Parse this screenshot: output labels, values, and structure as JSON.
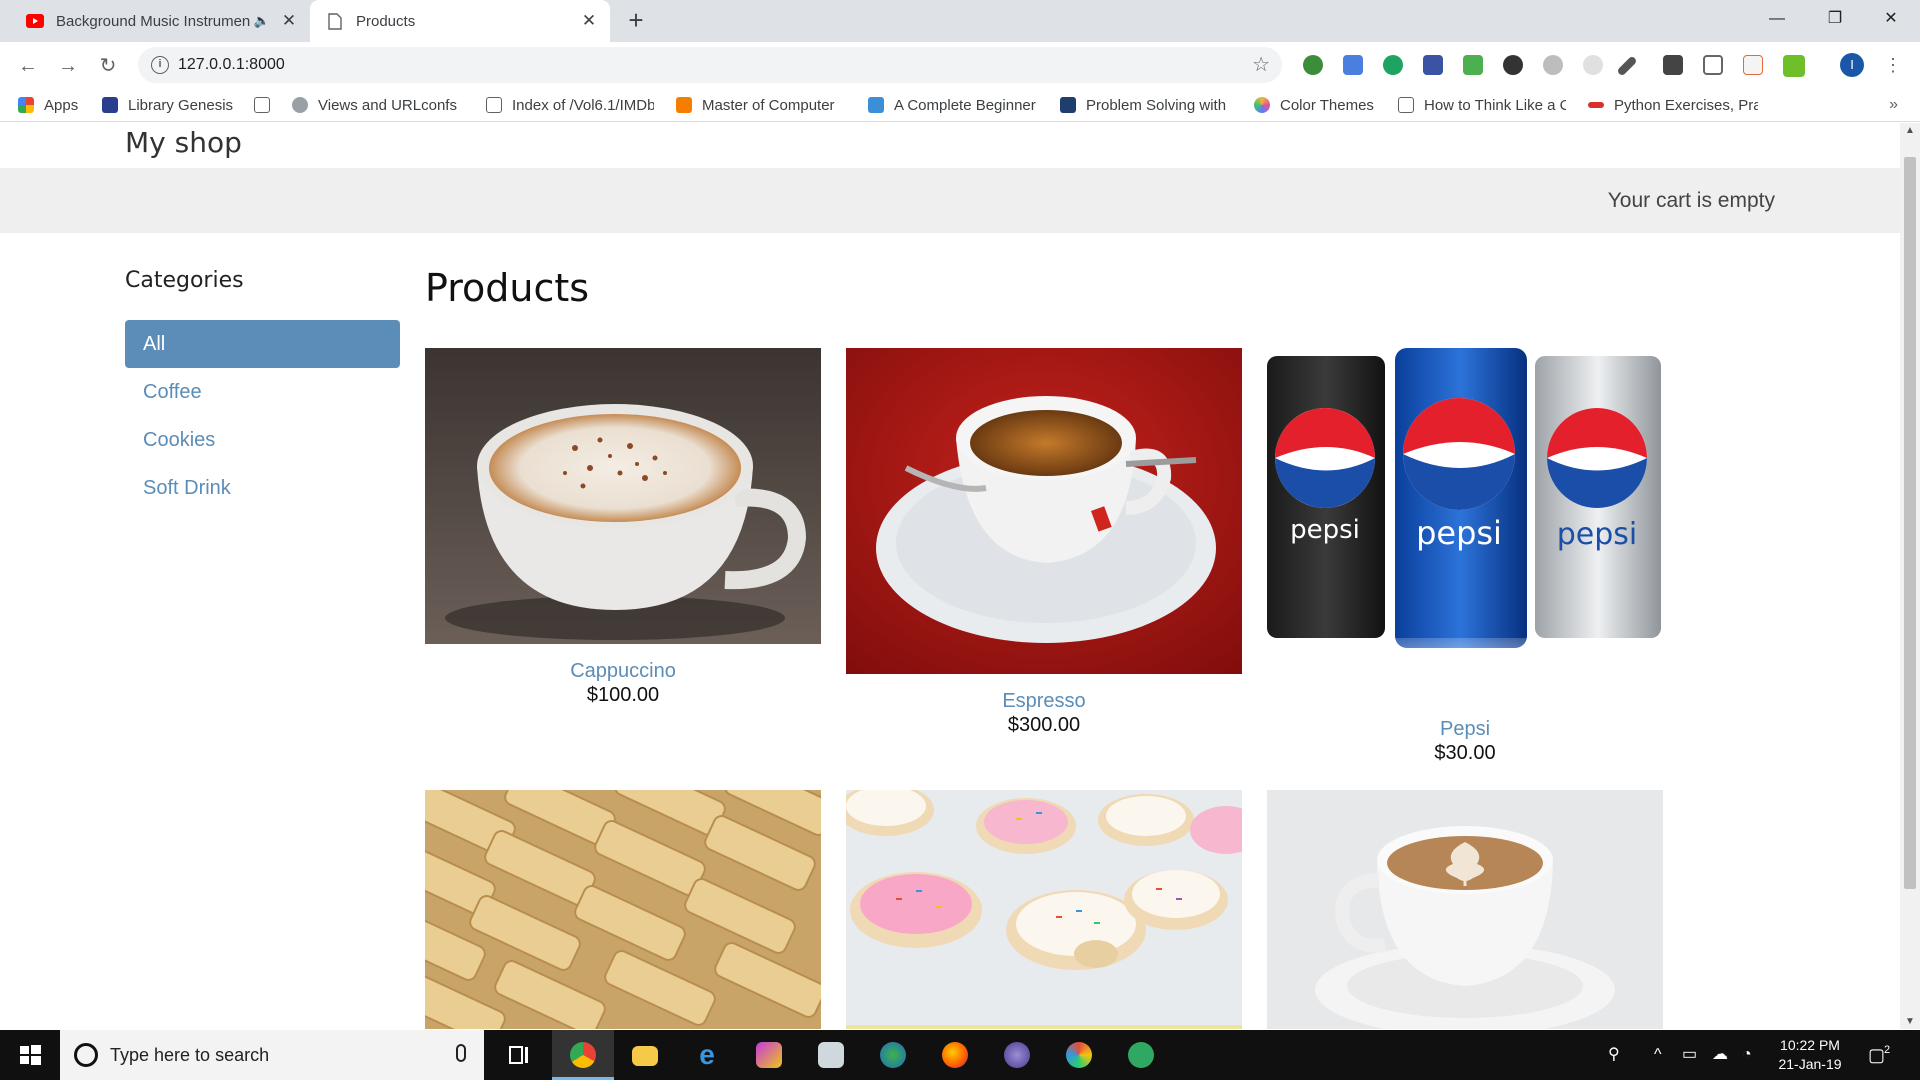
{
  "browser": {
    "tabs": [
      {
        "title": "Background Music Instrumen",
        "active": false,
        "audio": true
      },
      {
        "title": "Products",
        "active": true,
        "audio": false
      }
    ],
    "new_tab_label": "+",
    "url": "127.0.0.1:8000",
    "profile_initial": "I",
    "bookmarks": [
      {
        "label": "Apps",
        "icon": "apps-grid-icon",
        "color": "#e8453c"
      },
      {
        "label": "Library Genesis",
        "icon": "library-icon",
        "color": "#2a3d8f"
      },
      {
        "label": "Views and URLconfs",
        "icon": "gear-icon",
        "color": "#9aa0a6"
      },
      {
        "label": "Index of /Vol6.1/IMDb",
        "icon": "page-icon",
        "color": "#ffffff"
      },
      {
        "label": "Master of Computer",
        "icon": "blogger-icon",
        "color": "#f57d00"
      },
      {
        "label": "A Complete Beginner",
        "icon": "s-icon",
        "color": "#3b8fd6"
      },
      {
        "label": "Problem Solving with",
        "icon": "book-icon",
        "color": "#1f3e6e"
      },
      {
        "label": "Color Themes",
        "icon": "color-wheel-icon",
        "color": "#f2b33d"
      },
      {
        "label": "How to Think Like a C",
        "icon": "page-icon",
        "color": "#ffffff"
      },
      {
        "label": "Python Exercises, Pra",
        "icon": "w3resource-icon",
        "color": "#d9302c"
      }
    ],
    "bookmarks_overflow": "»"
  },
  "page": {
    "shop_title": "My shop",
    "cart_text": "Your cart is empty",
    "categories_heading": "Categories",
    "categories": [
      {
        "label": "All",
        "selected": true
      },
      {
        "label": "Coffee",
        "selected": false
      },
      {
        "label": "Cookies",
        "selected": false
      },
      {
        "label": "Soft Drink",
        "selected": false
      }
    ],
    "products_heading": "Products",
    "products": [
      {
        "name": "Cappuccino",
        "price": "$100.00",
        "image": "cappuccino-photo"
      },
      {
        "name": "Espresso",
        "price": "$300.00",
        "image": "espresso-photo"
      },
      {
        "name": "Pepsi",
        "price": "$30.00",
        "image": "pepsi-cans-photo",
        "can_labels": [
          "pepsi",
          "pepsi",
          "pepsi"
        ]
      },
      {
        "name": "",
        "price": "",
        "image": "shortbread-cookies-photo"
      },
      {
        "name": "",
        "price": "",
        "image": "sprinkle-cookies-photo"
      },
      {
        "name": "",
        "price": "",
        "image": "latte-photo"
      }
    ]
  },
  "taskbar": {
    "search_placeholder": "Type here to search",
    "time": "10:22 PM",
    "date": "21-Jan-19",
    "notification_count": "2"
  },
  "colors": {
    "accent": "#5b8db8",
    "subheader_bg": "#efefef",
    "taskbar_bg": "#101010"
  }
}
